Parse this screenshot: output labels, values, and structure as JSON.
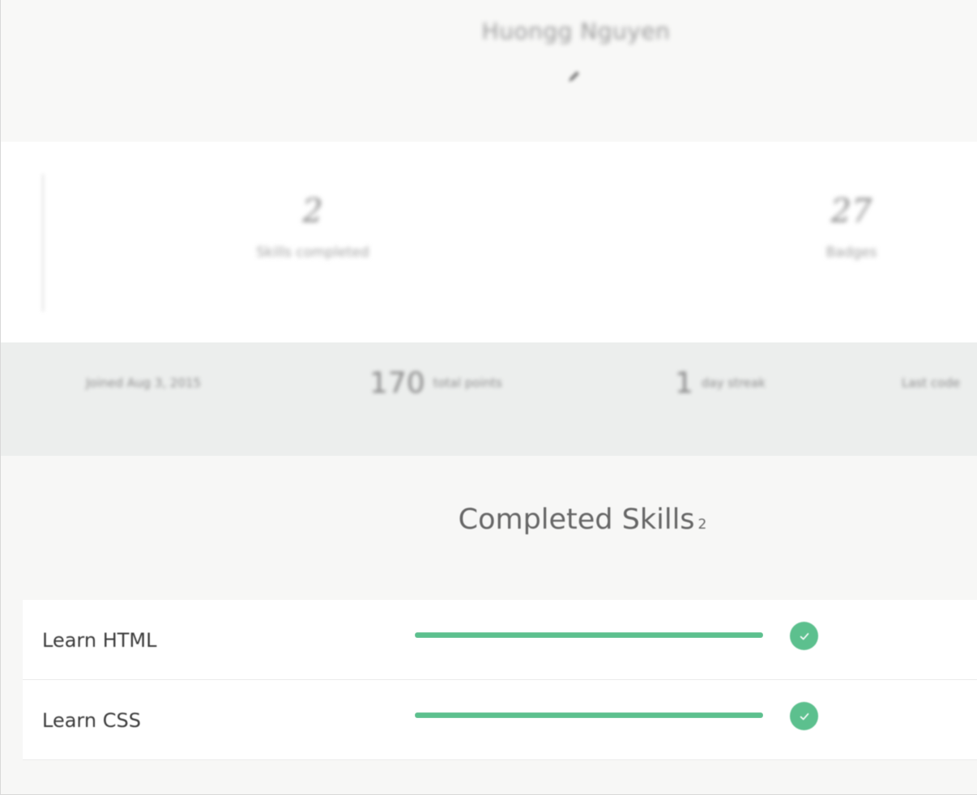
{
  "profile": {
    "name": "Huongg Nguyen",
    "edit_icon": "pencil-icon"
  },
  "stats": {
    "skills_completed": {
      "value": "2",
      "label": "Skills completed"
    },
    "badges": {
      "value": "27",
      "label": "Badges"
    }
  },
  "band": {
    "joined": "Joined Aug 3, 2015",
    "points_value": "170",
    "points_label": "total points",
    "streak_value": "1",
    "streak_label": "day streak",
    "last_code": "Last code"
  },
  "completed_skills": {
    "title": "Completed Skills",
    "count": "2",
    "items": [
      {
        "label": "Learn HTML",
        "progress": 1.0,
        "status_icon": "check-circle-icon"
      },
      {
        "label": "Learn CSS",
        "progress": 1.0,
        "status_icon": "check-circle-icon"
      }
    ]
  },
  "colors": {
    "accent_green": "#5cc08e",
    "band_gray": "#eceeed"
  }
}
